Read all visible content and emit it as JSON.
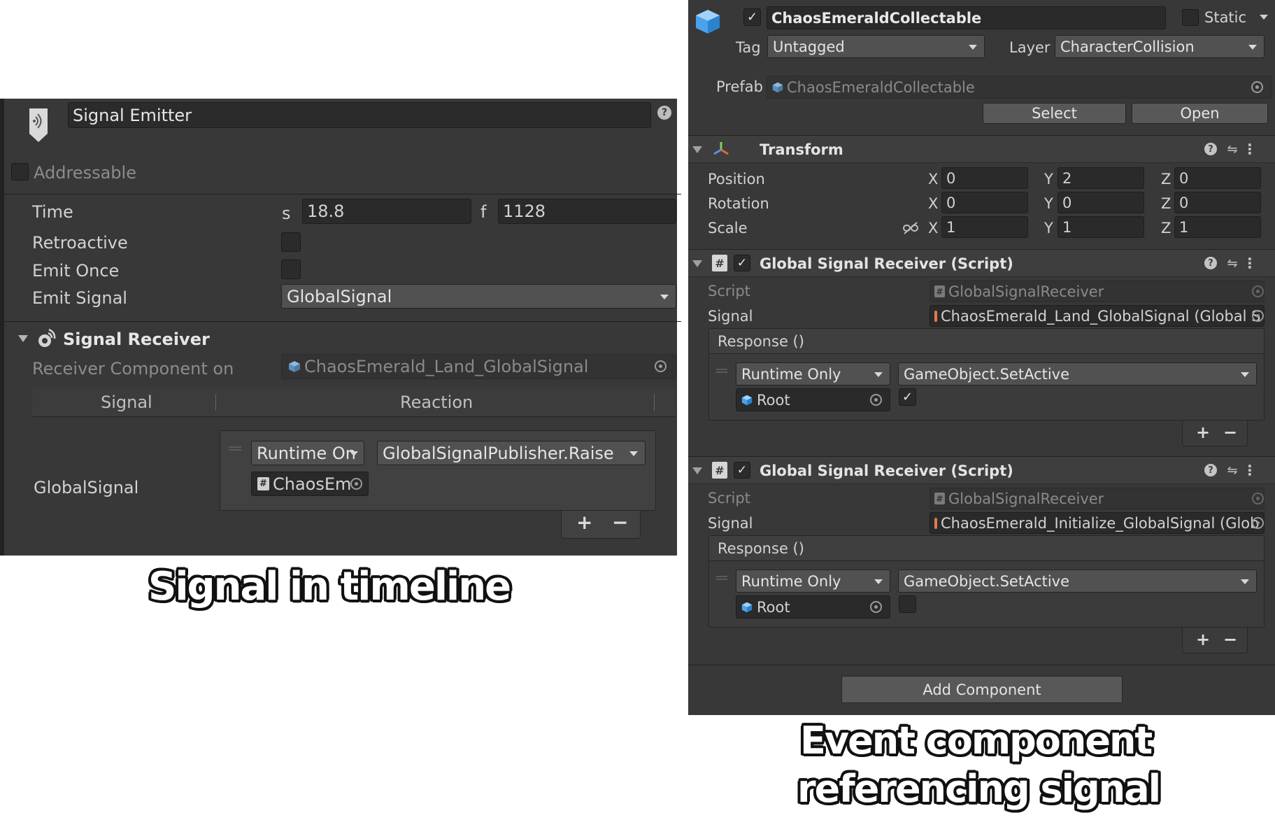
{
  "left_panel": {
    "title": "Signal Emitter",
    "addressable_label": "Addressable",
    "time_label": "Time",
    "time_s_label": "s",
    "time_s_value": "18.8",
    "time_f_label": "f",
    "time_f_value": "1128",
    "retroactive_label": "Retroactive",
    "emit_once_label": "Emit Once",
    "emit_signal_label": "Emit Signal",
    "emit_signal_value": "GlobalSignal",
    "receiver_section": "Signal Receiver",
    "receiver_component_label": "Receiver Component on",
    "receiver_component_value": "ChaosEmerald_Land_GlobalSignal",
    "table_headers": [
      "Signal",
      "Reaction"
    ],
    "row_signal": "GlobalSignal",
    "runtime_dropdown": "Runtime On",
    "method_dropdown": "GlobalSignalPublisher.Raise",
    "object_ref": "ChaosEm",
    "plus": "+",
    "minus": "−"
  },
  "right_panel": {
    "object_name": "ChaosEmeraldCollectable",
    "static_label": "Static",
    "tag_label": "Tag",
    "tag_value": "Untagged",
    "layer_label": "Layer",
    "layer_value": "CharacterCollision",
    "prefab_label": "Prefab",
    "prefab_value": "ChaosEmeraldCollectable",
    "select_button": "Select",
    "open_button": "Open",
    "transform": {
      "title": "Transform",
      "rows": [
        {
          "label": "Position",
          "x": "0",
          "y": "2",
          "z": "0"
        },
        {
          "label": "Rotation",
          "x": "0",
          "y": "0",
          "z": "0"
        },
        {
          "label": "Scale",
          "x": "1",
          "y": "1",
          "z": "1"
        }
      ],
      "axis_x": "X",
      "axis_y": "Y",
      "axis_z": "Z"
    },
    "receivers": [
      {
        "title": "Global Signal Receiver (Script)",
        "script_label": "Script",
        "script_value": "GlobalSignalReceiver",
        "signal_label": "Signal",
        "signal_value": "ChaosEmerald_Land_GlobalSignal (Global S",
        "response_label": "Response ()",
        "runtime_value": "Runtime Only",
        "method_value": "GameObject.SetActive",
        "object_value": "Root",
        "bool_checked": true
      },
      {
        "title": "Global Signal Receiver (Script)",
        "script_label": "Script",
        "script_value": "GlobalSignalReceiver",
        "signal_label": "Signal",
        "signal_value": "ChaosEmerald_Initialize_GlobalSignal (Glob",
        "response_label": "Response ()",
        "runtime_value": "Runtime Only",
        "method_value": "GameObject.SetActive",
        "object_value": "Root",
        "bool_checked": false
      }
    ],
    "add_component": "Add Component",
    "plus": "+",
    "minus": "−",
    "checkmark": "✓",
    "hash": "#"
  },
  "captions": {
    "left": "Signal in timeline",
    "right_line1": "Event component",
    "right_line2": "referencing signal"
  },
  "colors": {
    "panel_bg": "#383838",
    "field_bg": "#2a2a2a",
    "dropdown_bg": "#515151",
    "text": "#d2d2d2",
    "prefab_blue": "#7fb7e6"
  }
}
